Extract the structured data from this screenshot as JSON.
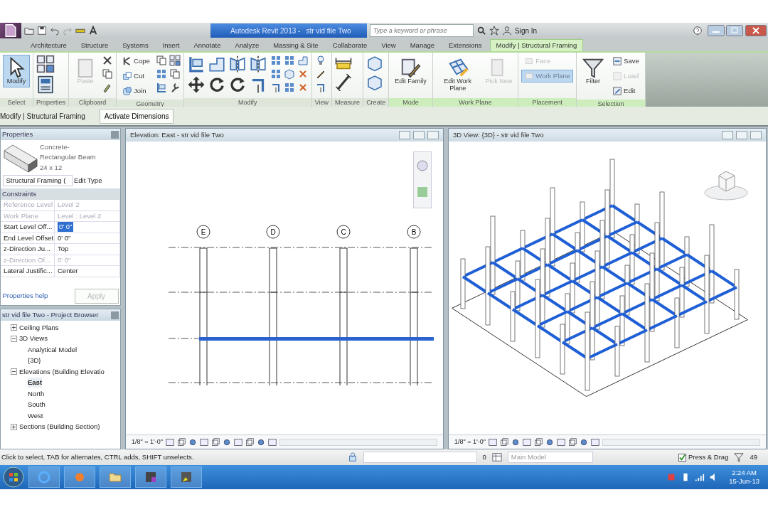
{
  "title_bar": {
    "app": "Autodesk Revit 2013 -",
    "file": "str vid file Two",
    "search": {
      "placeholder": "Type a keyword or phrase"
    },
    "sign_in": "Sign In"
  },
  "ribbon_tabs": [
    {
      "label": "Architecture",
      "selected": false
    },
    {
      "label": "Structure",
      "selected": false
    },
    {
      "label": "Systems",
      "selected": false
    },
    {
      "label": "Insert",
      "selected": false
    },
    {
      "label": "Annotate",
      "selected": false
    },
    {
      "label": "Analyze",
      "selected": false
    },
    {
      "label": "Massing & Site",
      "selected": false
    },
    {
      "label": "Collaborate",
      "selected": false
    },
    {
      "label": "View",
      "selected": false
    },
    {
      "label": "Manage",
      "selected": false
    },
    {
      "label": "Extensions",
      "selected": false
    },
    {
      "label": "Modify | Structural Framing",
      "selected": true
    }
  ],
  "ribbon_panels": [
    {
      "title": "Select",
      "tools": [
        {
          "label": "Modify",
          "kind": "large",
          "selected": true,
          "disabled": false
        }
      ]
    },
    {
      "title": "Properties"
    },
    {
      "title": "Clipboard",
      "tools": [
        {
          "label": "Paste",
          "kind": "large",
          "selected": false,
          "disabled": true
        }
      ]
    },
    {
      "title": "Geometry",
      "tools": [
        {
          "label": "Cope",
          "kind": "small",
          "selected": false,
          "disabled": false
        },
        {
          "label": "Cut",
          "kind": "small",
          "selected": false,
          "disabled": false
        },
        {
          "label": "Join",
          "kind": "small",
          "selected": false,
          "disabled": false
        }
      ]
    },
    {
      "title": "Modify"
    },
    {
      "title": "View"
    },
    {
      "title": "Measure"
    },
    {
      "title": "Create"
    },
    {
      "title": "Mode",
      "tools": [
        {
          "label": "Edit Family",
          "kind": "large",
          "selected": false,
          "disabled": false
        }
      ]
    },
    {
      "title": "Work Plane",
      "tools": [
        {
          "label": "Edit Work Plane",
          "kind": "large",
          "selected": false,
          "disabled": false
        },
        {
          "label": "Pick New",
          "kind": "large",
          "selected": false,
          "disabled": true
        }
      ]
    },
    {
      "title": "Placement",
      "tools": [
        {
          "label": "Face",
          "kind": "small",
          "selected": false,
          "disabled": true
        },
        {
          "label": "Work Plane",
          "kind": "small",
          "selected": true,
          "disabled": true
        }
      ]
    },
    {
      "title": "Selection",
      "tools": [
        {
          "label": "Filter",
          "kind": "large",
          "selected": false,
          "disabled": false
        },
        {
          "label": "Save",
          "kind": "small",
          "selected": false,
          "disabled": false
        },
        {
          "label": "Load",
          "kind": "small",
          "selected": false,
          "disabled": true
        },
        {
          "label": "Edit",
          "kind": "small",
          "selected": false,
          "disabled": false
        }
      ]
    }
  ],
  "options_bar": {
    "context": "Modify | Structural Framing",
    "button": "Activate Dimensions"
  },
  "properties": {
    "title": "Properties",
    "family": "Concrete-Rectangular Beam",
    "type": "24 x 12",
    "selector": "Structural Framing (",
    "edit_type": "Edit Type",
    "group": "Constraints",
    "rows": [
      {
        "name": "Reference Level",
        "value": "Level 2",
        "disabled": true,
        "selected": false
      },
      {
        "name": "Work Plane",
        "value": "Level : Level 2",
        "disabled": true,
        "selected": false
      },
      {
        "name": "Start Level Off...",
        "value": "0' 0\"",
        "disabled": false,
        "selected": true
      },
      {
        "name": "End Level Offset",
        "value": "0' 0\"",
        "disabled": false,
        "selected": false
      },
      {
        "name": "z-Direction Ju...",
        "value": "Top",
        "disabled": false,
        "selected": false
      },
      {
        "name": "z-Direction Of...",
        "value": "0' 0\"",
        "disabled": true,
        "selected": false
      },
      {
        "name": "Lateral Justific...",
        "value": "Center",
        "disabled": false,
        "selected": false
      }
    ],
    "help": "Properties help",
    "apply": {
      "label": "Apply",
      "disabled": true
    }
  },
  "project_browser": {
    "title": "str vid file Two - Project Browser",
    "tree": [
      {
        "label": "Ceiling Plans",
        "expanded": false,
        "selected": false
      },
      {
        "label": "3D Views",
        "expanded": true,
        "selected": false,
        "children": [
          {
            "label": "Analytical Model",
            "selected": false
          },
          {
            "label": "{3D}",
            "selected": false
          }
        ]
      },
      {
        "label": "Elevations (Building Elevatio",
        "expanded": true,
        "selected": false,
        "children": [
          {
            "label": "East",
            "selected": true
          },
          {
            "label": "North",
            "selected": false
          },
          {
            "label": "South",
            "selected": false
          },
          {
            "label": "West",
            "selected": false
          }
        ]
      },
      {
        "label": "Sections (Building Section)",
        "expanded": false,
        "selected": false
      }
    ]
  },
  "views": [
    {
      "kind": "elevation",
      "title": "Elevation: East - str vid file Two",
      "scale": "1/8\" = 1'-0\"",
      "grid_labels": [
        "E",
        "D",
        "C",
        "B"
      ]
    },
    {
      "kind": "isometric",
      "title": "3D View: {3D} - str vid file Two",
      "scale": "1/8\" = 1'-0\""
    }
  ],
  "status_bar": {
    "message": "Click to select, TAB for alternates, CTRL adds, SHIFT unselects.",
    "selection_count": "0",
    "model": "Main Model",
    "press_drag": {
      "label": "Press & Drag",
      "checked": true
    },
    "filter_count": "49"
  },
  "taskbar": {
    "time": "2:24 AM",
    "date": "15-Jun-13"
  }
}
